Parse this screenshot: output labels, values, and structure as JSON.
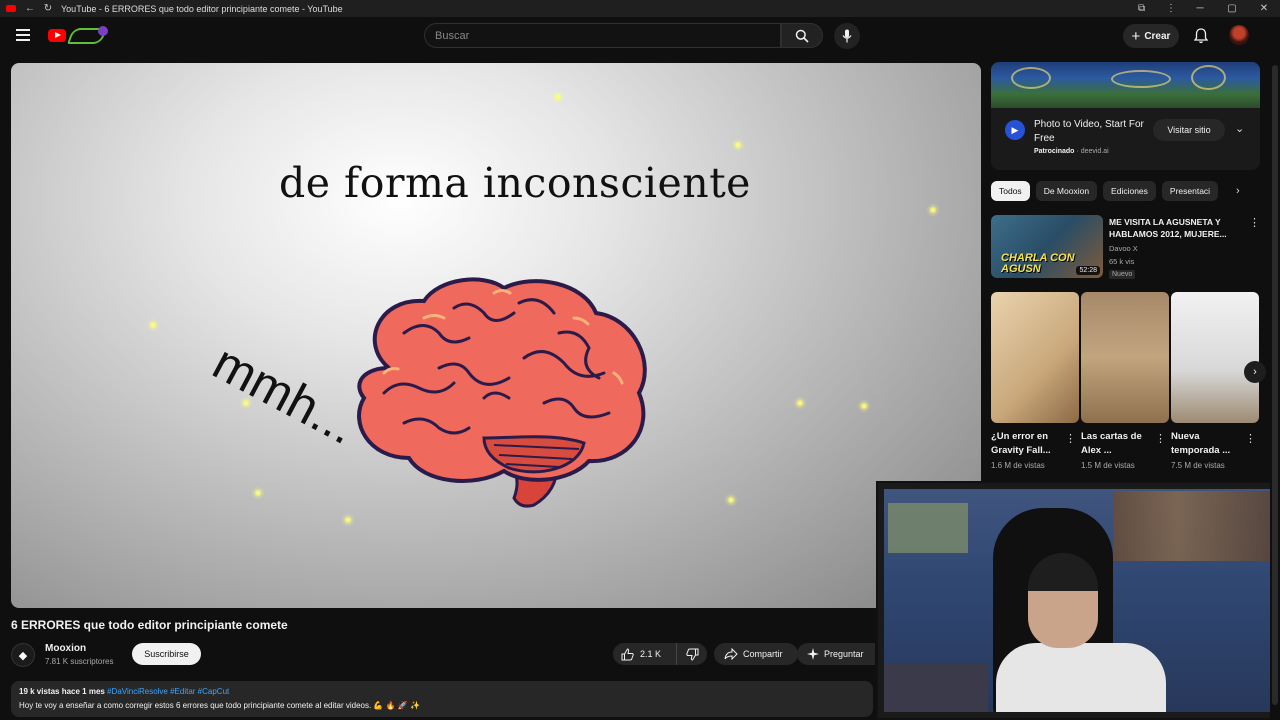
{
  "browser": {
    "tab_title": "YouTube - 6 ERRORES que todo editor principiante comete - YouTube",
    "window_controls": {
      "minimize": "─",
      "maximize": "▢",
      "close": "✕"
    }
  },
  "masthead": {
    "search_placeholder": "Buscar",
    "create_label": "Crear"
  },
  "player": {
    "caption": "de forma inconsciente",
    "side_text": "mmh..."
  },
  "video": {
    "title": "6 ERRORES que todo editor principiante comete",
    "channel": "Mooxion",
    "subscribers": "7.81 K suscriptores",
    "subscribe_label": "Suscribirse",
    "likes": "2.1 K",
    "share_label": "Compartir",
    "ask_label": "Preguntar",
    "views": "19 k vistas",
    "date": "hace 1 mes",
    "tags": "#DaVinciResolve #Editar #CapCut",
    "description": "Hoy te voy a enseñar a como corregir estos 6 errores que todo principiante comete al editar videos. 💪 🔥 🚀 ✨"
  },
  "ad": {
    "title": "Photo to Video, Start For Free",
    "sponsored_label": "Patrocinado",
    "domain": "deevid.ai",
    "visit_label": "Visitar sitio"
  },
  "chips": [
    "Todos",
    "De Mooxion",
    "Ediciones",
    "Presentaci"
  ],
  "rec": {
    "title": "ME VISITA LA AGUSNETA Y HABLAMOS 2012, MUJERE...",
    "channel": "Davoo X",
    "views": "65 k vis",
    "badge": "Nuevo",
    "duration": "52:28",
    "thumb_text": "CHARLA CON AGUSN"
  },
  "shorts": [
    {
      "title": "¿Un error en Gravity Fall...",
      "views": "1.6 M de vistas"
    },
    {
      "title": "Las cartas de Alex ...",
      "views": "1.5 M de vistas"
    },
    {
      "title": "Nueva temporada ...",
      "views": "7.5 M de vistas"
    }
  ],
  "icons": {
    "hamburger": "menu-icon",
    "search": "search-icon",
    "mic": "mic-icon",
    "bell": "bell-icon",
    "like": "thumbs-up-icon",
    "dislike": "thumbs-down-icon",
    "share": "share-icon",
    "ask": "sparkle-icon"
  },
  "colors": {
    "background": "#0f0f0f",
    "accent": "#ff0000",
    "link": "#3ea6ff"
  }
}
